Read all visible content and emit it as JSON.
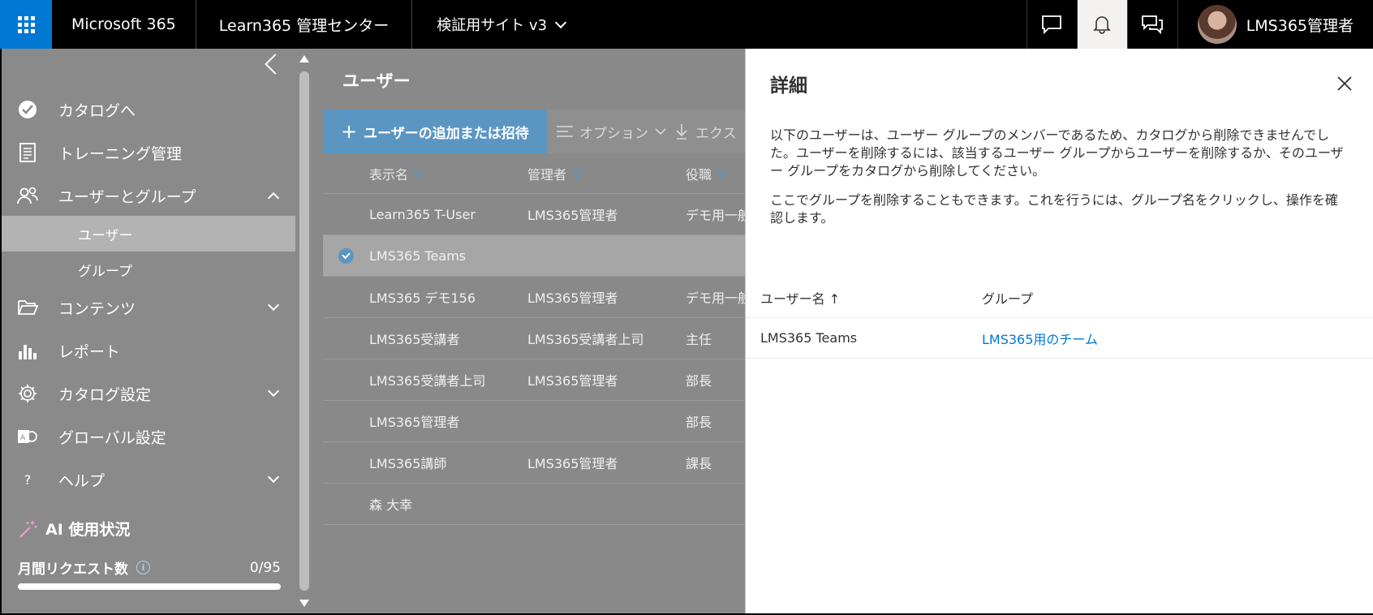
{
  "topbar": {
    "brand": "Microsoft 365",
    "site_title": "Learn365 管理センター",
    "site_selector": "検証用サイト v3",
    "user_name": "LMS365管理者",
    "accent": "#0078d4"
  },
  "sidebar": {
    "items": [
      {
        "label": "カタログへ",
        "icon": "catalog-check-icon"
      },
      {
        "label": "トレーニング管理",
        "icon": "training-document-icon"
      },
      {
        "label": "ユーザーとグループ",
        "icon": "people-icon"
      },
      {
        "label": "コンテンツ",
        "icon": "folder-open-icon"
      },
      {
        "label": "レポート",
        "icon": "bar-chart-icon"
      },
      {
        "label": "カタログ設定",
        "icon": "gear-icon"
      },
      {
        "label": "グローバル設定",
        "icon": "global-settings-icon"
      },
      {
        "label": "ヘルプ",
        "icon": "help-icon"
      }
    ],
    "subitems": [
      {
        "label": "ユーザー",
        "selected": true
      },
      {
        "label": "グループ",
        "selected": false
      }
    ],
    "ai_usage": {
      "title": "AI 使用状況",
      "requests_label": "月間リクエスト数",
      "requests_count": "0/95",
      "progress_fraction": 0.0
    }
  },
  "main": {
    "page_title": "ユーザー",
    "toolbar": {
      "add_label": "ユーザーの追加または招待",
      "options_label": "オプション",
      "export_label": "エクス"
    },
    "table": {
      "headers": [
        "表示名",
        "管理者",
        "役職"
      ],
      "rows": [
        [
          "Learn365 T-User",
          "LMS365管理者",
          "デモ用一般"
        ],
        [
          "LMS365 Teams",
          "",
          ""
        ],
        [
          "LMS365 デモ156",
          "LMS365管理者",
          "デモ用一般"
        ],
        [
          "LMS365受講者",
          "LMS365受講者上司",
          "主任"
        ],
        [
          "LMS365受講者上司",
          "LMS365管理者",
          "部長"
        ],
        [
          "LMS365管理者",
          "",
          "部長"
        ],
        [
          "LMS365講師",
          "LMS365管理者",
          "課長"
        ],
        [
          "森 大幸",
          "",
          ""
        ]
      ],
      "selected_row": 1
    }
  },
  "panel": {
    "title": "詳細",
    "message1": "以下のユーザーは、ユーザー グループのメンバーであるため、カタログから削除できませんでした。ユーザーを削除するには、該当するユーザー グループからユーザーを削除するか、そのユーザー グループをカタログから削除してください。",
    "message2": "ここでグループを削除することもできます。これを行うには、グループ名をクリックし、操作を確認します。",
    "table": {
      "col_user": "ユーザー名 ↑",
      "col_group": "グループ",
      "rows": [
        {
          "user": "LMS365 Teams",
          "group": "LMS365用のチーム"
        }
      ]
    }
  }
}
